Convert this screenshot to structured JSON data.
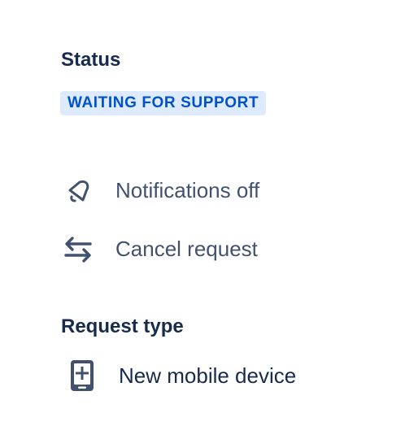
{
  "status": {
    "heading": "Status",
    "badge": "WAITING FOR SUPPORT",
    "badge_bg": "#deebff",
    "badge_fg": "#0052cc"
  },
  "actions": [
    {
      "label": "Notifications off",
      "icon": "bell-slash-icon"
    },
    {
      "label": "Cancel request",
      "icon": "transition-arrows-icon"
    }
  ],
  "request_type": {
    "heading": "Request type",
    "value": "New mobile device",
    "icon": "mobile-device-add-icon"
  },
  "colors": {
    "heading": "#172b4d",
    "action_text": "#42526e",
    "icon": "#42526e"
  }
}
